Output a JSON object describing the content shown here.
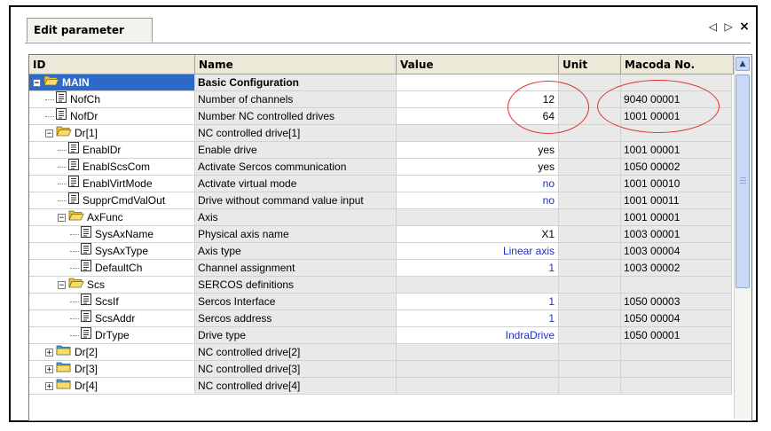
{
  "tab": {
    "label": "Edit parameter"
  },
  "tab_controls": {
    "left": "◁",
    "right": "▷",
    "close": "×"
  },
  "columns": {
    "id": "ID",
    "name": "Name",
    "value": "Value",
    "unit": "Unit",
    "macoda": "Macoda No."
  },
  "rows": [
    {
      "id": "MAIN",
      "name": "Basic Configuration",
      "value": "",
      "unit": "",
      "macoda": ""
    },
    {
      "id": "NofCh",
      "name": "Number of channels",
      "value": "12",
      "unit": "",
      "macoda": "9040 00001"
    },
    {
      "id": "NofDr",
      "name": "Number NC controlled drives",
      "value": "64",
      "unit": "",
      "macoda": "1001 00001"
    },
    {
      "id": "Dr[1]",
      "name": "NC controlled drive[1]",
      "value": "",
      "unit": "",
      "macoda": ""
    },
    {
      "id": "EnablDr",
      "name": "Enable drive",
      "value": "yes",
      "unit": "",
      "macoda": "1001 00001"
    },
    {
      "id": "EnablScsCom",
      "name": "Activate Sercos communication",
      "value": "yes",
      "unit": "",
      "macoda": "1050 00002"
    },
    {
      "id": "EnablVirtMode",
      "name": "Activate virtual mode",
      "value": "no",
      "unit": "",
      "macoda": "1001 00010"
    },
    {
      "id": "SupprCmdValOut",
      "name": "Drive without command value input",
      "value": "no",
      "unit": "",
      "macoda": "1001 00011"
    },
    {
      "id": "AxFunc",
      "name": "Axis",
      "value": "",
      "unit": "",
      "macoda": "1001 00001"
    },
    {
      "id": "SysAxName",
      "name": "Physical axis name",
      "value": "X1",
      "unit": "",
      "macoda": "1003 00001"
    },
    {
      "id": "SysAxType",
      "name": "Axis type",
      "value": "Linear axis",
      "unit": "",
      "macoda": "1003 00004"
    },
    {
      "id": "DefaultCh",
      "name": "Channel assignment",
      "value": "1",
      "unit": "",
      "macoda": "1003 00002"
    },
    {
      "id": "Scs",
      "name": "SERCOS definitions",
      "value": "",
      "unit": "",
      "macoda": ""
    },
    {
      "id": "ScsIf",
      "name": "Sercos Interface",
      "value": "1",
      "unit": "",
      "macoda": "1050 00003"
    },
    {
      "id": "ScsAddr",
      "name": "Sercos address",
      "value": "1",
      "unit": "",
      "macoda": "1050 00004"
    },
    {
      "id": "DrType",
      "name": "Drive type",
      "value": "IndraDrive",
      "unit": "",
      "macoda": "1050 00001"
    },
    {
      "id": "Dr[2]",
      "name": "NC controlled drive[2]",
      "value": "",
      "unit": "",
      "macoda": ""
    },
    {
      "id": "Dr[3]",
      "name": "NC controlled drive[3]",
      "value": "",
      "unit": "",
      "macoda": ""
    },
    {
      "id": "Dr[4]",
      "name": "NC controlled drive[4]",
      "value": "",
      "unit": "",
      "macoda": ""
    }
  ],
  "colors": {
    "value_blue": "#1c2fd1",
    "selection": "#2d6ac7",
    "annotation_red": "#e03030"
  }
}
